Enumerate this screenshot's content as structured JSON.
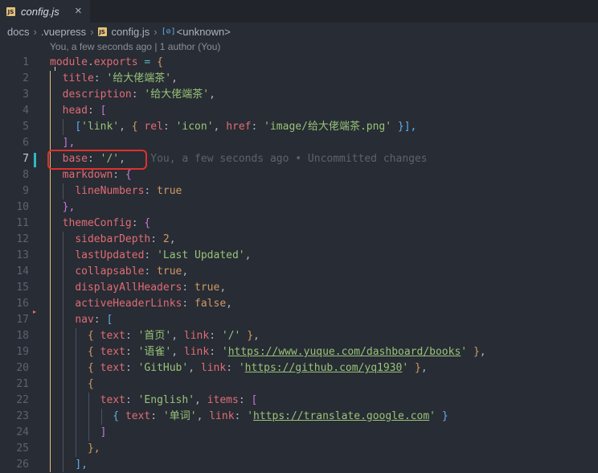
{
  "tab": {
    "badge": "JS",
    "name": "config.js",
    "close": "×"
  },
  "breadcrumb": {
    "sep": "›",
    "items": [
      "docs",
      ".vuepress"
    ],
    "file": "config.js",
    "symbol_icon": "[⊘]",
    "symbol": "<unknown>"
  },
  "blame_header": "You, a few seconds ago | 1 author (You)",
  "inline_blame": "You, a few seconds ago • Uncommitted changes",
  "line_numbers": [
    "1",
    "2",
    "3",
    "4",
    "5",
    "6",
    "7",
    "8",
    "9",
    "10",
    "11",
    "12",
    "13",
    "14",
    "15",
    "16",
    "17",
    "18",
    "19",
    "20",
    "21",
    "22",
    "23",
    "24",
    "25",
    "26"
  ],
  "code": {
    "l1": {
      "a": "module",
      "b": ".",
      "c": "exports",
      "d": " = ",
      "e": "{"
    },
    "l2": {
      "key": "title",
      "val": "'给大佬端茶'"
    },
    "l3": {
      "key": "description",
      "val": "'给大佬端茶'"
    },
    "l4": {
      "key": "head",
      "open": "["
    },
    "l5": {
      "o": "[",
      "s1": "'link'",
      "o2": "{",
      "k1": "rel",
      "s2": "'icon'",
      "k2": "href",
      "s3": "'image/给大佬端茶.png'",
      "c": "}],"
    },
    "l6": {
      "close": "],"
    },
    "l7": {
      "key": "base",
      "val": "'/'"
    },
    "l8": {
      "key": "markdown",
      "open": "{"
    },
    "l9": {
      "key": "lineNumbers",
      "val": "true"
    },
    "l10": {
      "close": "},"
    },
    "l11": {
      "key": "themeConfig",
      "open": "{"
    },
    "l12": {
      "key": "sidebarDepth",
      "val": "2"
    },
    "l13": {
      "key": "lastUpdated",
      "val": "'Last Updated'"
    },
    "l14": {
      "key": "collapsable",
      "val": "true"
    },
    "l15": {
      "key": "displayAllHeaders",
      "val": "true"
    },
    "l16": {
      "key": "activeHeaderLinks",
      "val": "false"
    },
    "l17": {
      "key": "nav",
      "open": "["
    },
    "l18": {
      "k1": "text",
      "s1": "'首页'",
      "k2": "link",
      "s2": "'/'"
    },
    "l19": {
      "k1": "text",
      "s1": "'语雀'",
      "k2": "link",
      "q": "'",
      "url": "https://www.yuque.com/dashboard/books"
    },
    "l20": {
      "k1": "text",
      "s1": "'GitHub'",
      "k2": "link",
      "q": "'",
      "url": "https://github.com/yq1930"
    },
    "l21": {
      "open": "{"
    },
    "l22": {
      "k1": "text",
      "s1": "'English'",
      "k2": "items",
      "open": "["
    },
    "l23": {
      "k1": "text",
      "s1": "'单词'",
      "k2": "link",
      "q": "'",
      "url": "https://translate.google.com"
    },
    "l24": {
      "close": "]"
    },
    "l25": {
      "close": "},"
    },
    "l26": {
      "close": "],"
    }
  },
  "colors": {
    "background": "#282c34",
    "key": "#e06c75",
    "string": "#98c379",
    "number": "#d19a66",
    "highlight_box": "#e0312a",
    "git_change": "#2bbac5"
  }
}
